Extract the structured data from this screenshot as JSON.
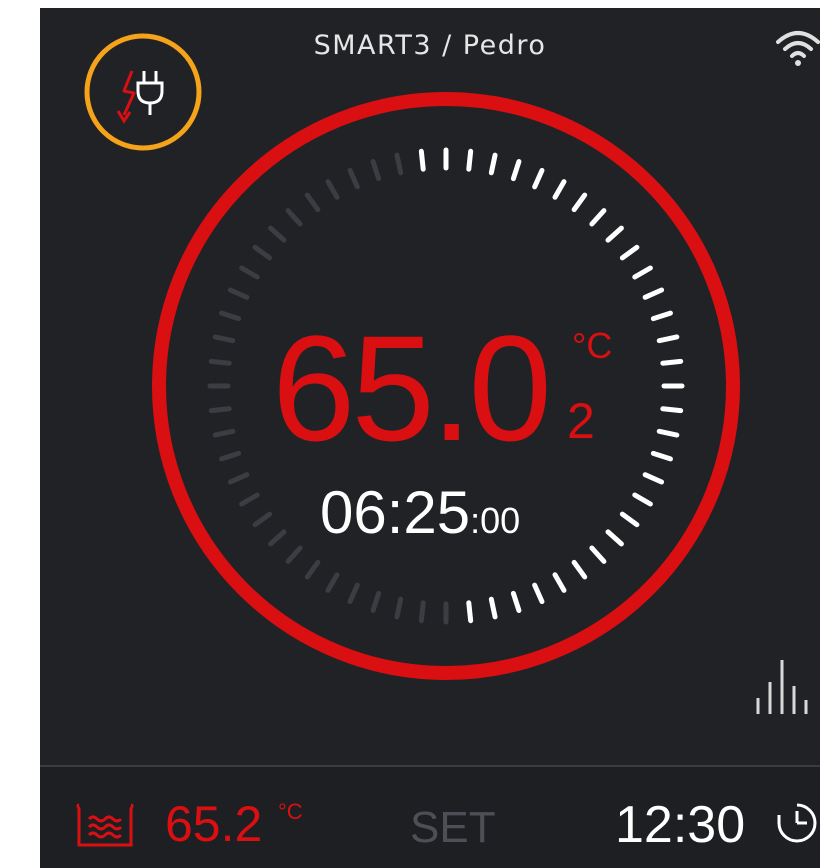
{
  "header": {
    "title": "SMART3 / Pedro"
  },
  "icons": {
    "wifi": "wifi-icon",
    "power": "power-plug-icon",
    "graph": "graph-icon",
    "bath": "water-bath-icon",
    "timer": "timer-icon"
  },
  "colors": {
    "background": "#212226",
    "accent": "#d90f12",
    "badge_ring": "#f5a31a",
    "text": "#ffffff"
  },
  "main": {
    "temperature": "65.0",
    "temperature_decimal": "2",
    "temperature_unit": "°C",
    "timer_main": "06:25",
    "timer_seconds": ":00",
    "dial_progress": 0.5
  },
  "footer": {
    "bath_temperature": "65.2",
    "bath_unit": "°C",
    "set_label": "SET",
    "clock": "12:30"
  }
}
